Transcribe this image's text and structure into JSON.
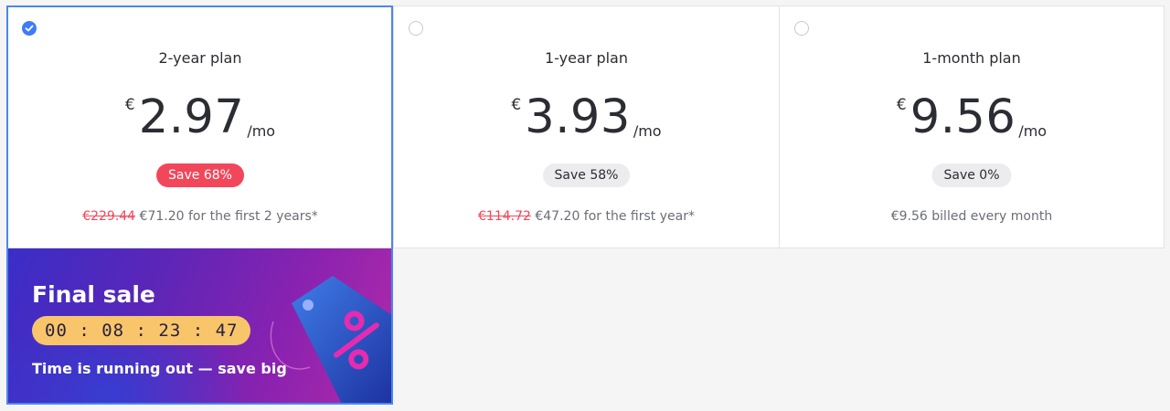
{
  "plans": [
    {
      "name": "2-year plan",
      "selected": true,
      "currency": "€",
      "price": "2.97",
      "per": "/mo",
      "badge": "Save 68%",
      "badge_style": "hot",
      "old_price": "€229.44",
      "note": " €71.20 for the first 2 years*"
    },
    {
      "name": "1-year plan",
      "selected": false,
      "currency": "€",
      "price": "3.93",
      "per": "/mo",
      "badge": "Save 58%",
      "badge_style": "neutral",
      "old_price": "€114.72",
      "note": " €47.20 for the first year*"
    },
    {
      "name": "1-month plan",
      "selected": false,
      "currency": "€",
      "price": "9.56",
      "per": "/mo",
      "badge": "Save 0%",
      "badge_style": "neutral",
      "old_price": "",
      "note": "€9.56 billed every month"
    }
  ],
  "promo": {
    "title": "Final sale",
    "timer": "00 : 08 : 23 : 47",
    "subtitle": "Time is running out — save big",
    "icon": "discount-tag-icon"
  },
  "colors": {
    "accent": "#3e7bfa",
    "save_badge": "#f2475b",
    "timer_bg": "#f8c56a"
  }
}
